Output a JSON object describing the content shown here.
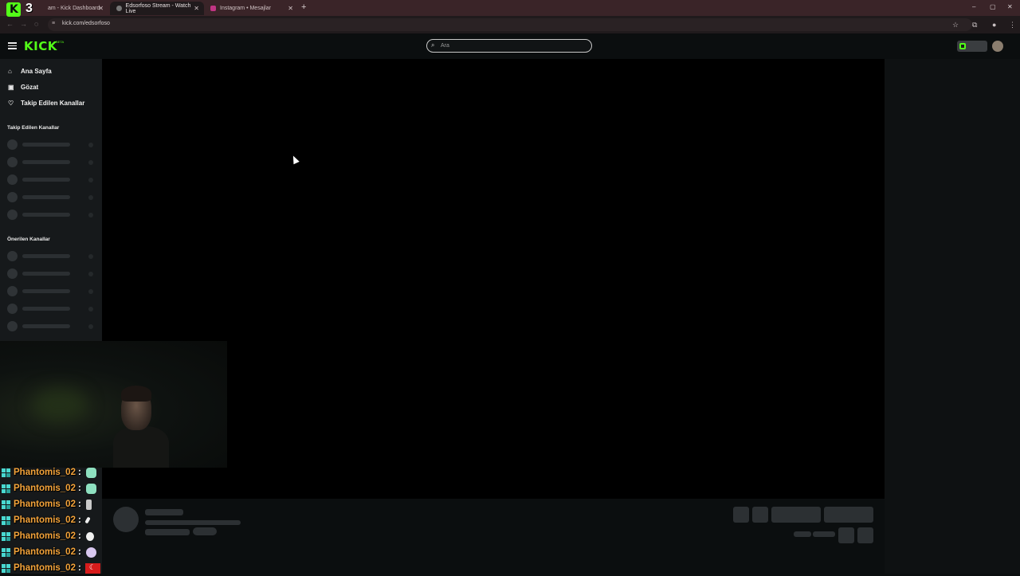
{
  "browser": {
    "tabs": [
      {
        "label": "am - Kick Dashboard",
        "active": false
      },
      {
        "label": "Edsorfoso Stream - Watch Live",
        "active": true
      },
      {
        "label": "Instagram • Mesajlar",
        "active": false
      }
    ],
    "new_tab": "+",
    "url": "kick.com/edsorfoso",
    "window_controls": [
      "–",
      "▢",
      "✕"
    ]
  },
  "overlay": {
    "counter": "3"
  },
  "header": {
    "logo": "KICK",
    "logo_badge": "BETA",
    "search_placeholder": "Ara"
  },
  "sidebar": {
    "nav": [
      {
        "label": "Ana Sayfa",
        "icon": "home-icon"
      },
      {
        "label": "Gözat",
        "icon": "browse-icon"
      },
      {
        "label": "Takip Edilen Kanallar",
        "icon": "heart-icon"
      }
    ],
    "followed_title": "Takip Edilen Kanallar",
    "recommended_title": "Önerilen Kanallar"
  },
  "chat": [
    {
      "user": "Phantomis_02",
      "emote": "green-ghost"
    },
    {
      "user": "Phantomis_02",
      "emote": "green-ghost"
    },
    {
      "user": "Phantomis_02",
      "emote": "bottle"
    },
    {
      "user": "Phantomis_02",
      "emote": "feather"
    },
    {
      "user": "Phantomis_02",
      "emote": "rabbit"
    },
    {
      "user": "Phantomis_02",
      "emote": "purple-ghost"
    },
    {
      "user": "Phantomis_02",
      "emote": "turkey-flag"
    }
  ],
  "colors": {
    "accent": "#53fc18",
    "username": "#f3a33a"
  }
}
